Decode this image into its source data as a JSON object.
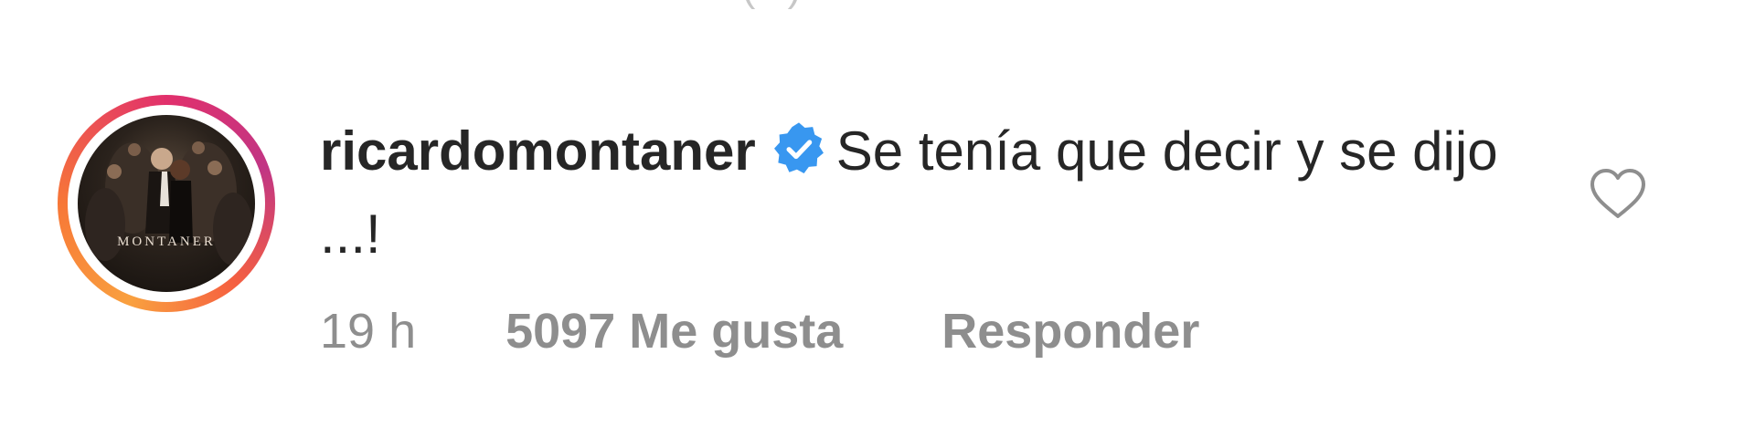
{
  "top_fragment": "· ···· (··)",
  "comment": {
    "avatar": {
      "text": "MONTANER",
      "ring_colors": [
        "#f9a03f",
        "#e1306c",
        "#c13584"
      ]
    },
    "username": "ricardomontaner",
    "verified": true,
    "verified_color": "#3897f0",
    "text": "Se tenía que decir y se dijo ...!",
    "time": "19 h",
    "likes": "5097 Me gusta",
    "reply_label": "Responder",
    "like_icon": "heart-outline-icon"
  }
}
